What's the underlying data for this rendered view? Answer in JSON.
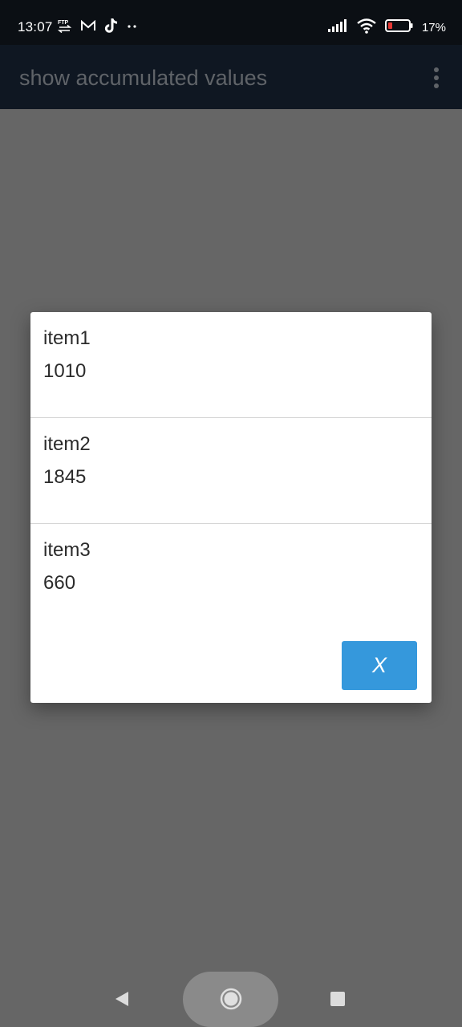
{
  "status_bar": {
    "time": "13:07",
    "left_icons": [
      "ftp-icon",
      "gmail-icon",
      "tiktok-icon",
      "more-dots-icon"
    ],
    "ftp_label": "FTP",
    "right_icons": [
      "signal-icon",
      "wifi-icon",
      "battery-icon"
    ],
    "battery_percent": "17%"
  },
  "app_bar": {
    "title": "show accumulated values",
    "overflow_icon": "more-vert-icon"
  },
  "dialog": {
    "items": [
      {
        "name": "item1",
        "value": "1010"
      },
      {
        "name": "item2",
        "value": "1845"
      },
      {
        "name": "item3",
        "value": "660"
      }
    ],
    "close_label": "X"
  },
  "nav_bar": {
    "icons": [
      "back-icon",
      "home-icon",
      "recents-icon"
    ]
  },
  "colors": {
    "status_bar": "#0b0f14",
    "app_bar": "#0f1722",
    "scrim": "#666666",
    "dialog_bg": "#ffffff",
    "accent": "#3598dc",
    "battery_low": "#e53935"
  }
}
